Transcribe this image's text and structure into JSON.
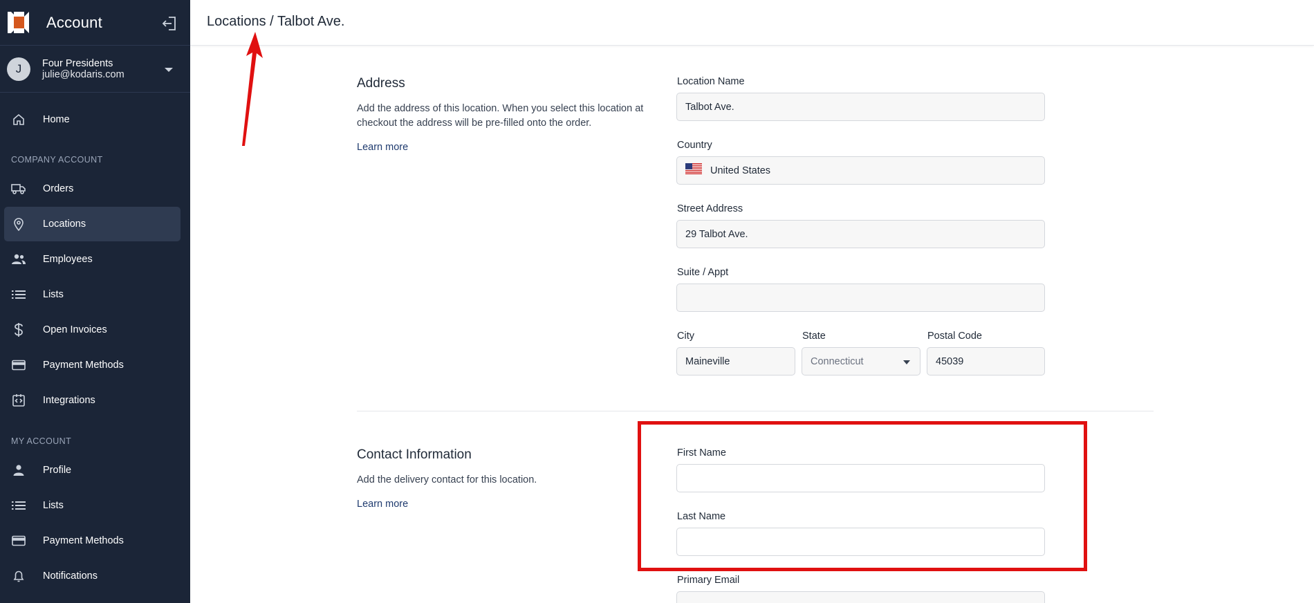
{
  "sidebar": {
    "app_title": "Account",
    "user": {
      "initial": "J",
      "name": "Four Presidents",
      "email": "julie@kodaris.com"
    },
    "home_label": "Home",
    "company_section": "COMPANY ACCOUNT",
    "company_items": [
      {
        "label": "Orders",
        "icon": "truck-icon"
      },
      {
        "label": "Locations",
        "icon": "map-pin-icon",
        "active": true
      },
      {
        "label": "Employees",
        "icon": "people-icon"
      },
      {
        "label": "Lists",
        "icon": "list-icon"
      },
      {
        "label": "Open Invoices",
        "icon": "dollar-icon"
      },
      {
        "label": "Payment Methods",
        "icon": "credit-card-icon"
      },
      {
        "label": "Integrations",
        "icon": "integration-icon"
      }
    ],
    "my_section": "MY ACCOUNT",
    "my_items": [
      {
        "label": "Profile",
        "icon": "person-icon"
      },
      {
        "label": "Lists",
        "icon": "list-icon"
      },
      {
        "label": "Payment Methods",
        "icon": "credit-card-icon"
      },
      {
        "label": "Notifications",
        "icon": "bell-icon"
      }
    ]
  },
  "header": {
    "breadcrumb_parent": "Locations",
    "breadcrumb_sep": " / ",
    "breadcrumb_current": "Talbot Ave."
  },
  "address": {
    "title": "Address",
    "description": "Add the address of this location. When you select this location at checkout the address will be pre-filled onto the order.",
    "learn_more": "Learn more",
    "location_name_label": "Location Name",
    "location_name_value": "Talbot Ave.",
    "country_label": "Country",
    "country_value": "United States",
    "street_label": "Street Address",
    "street_value": "29 Talbot Ave.",
    "suite_label": "Suite / Appt",
    "suite_value": "",
    "city_label": "City",
    "city_value": "Maineville",
    "state_label": "State",
    "state_value": "Connecticut",
    "postal_label": "Postal Code",
    "postal_value": "45039"
  },
  "contact": {
    "title": "Contact Information",
    "description": "Add the delivery contact for this location.",
    "learn_more": "Learn more",
    "first_name_label": "First Name",
    "first_name_value": "",
    "last_name_label": "Last Name",
    "last_name_value": "",
    "primary_email_label": "Primary Email"
  },
  "colors": {
    "sidebar_bg": "#1b2537",
    "active_item_bg": "#2f3b51",
    "annotation_red": "#e01010",
    "logo_orange": "#d4571d"
  }
}
